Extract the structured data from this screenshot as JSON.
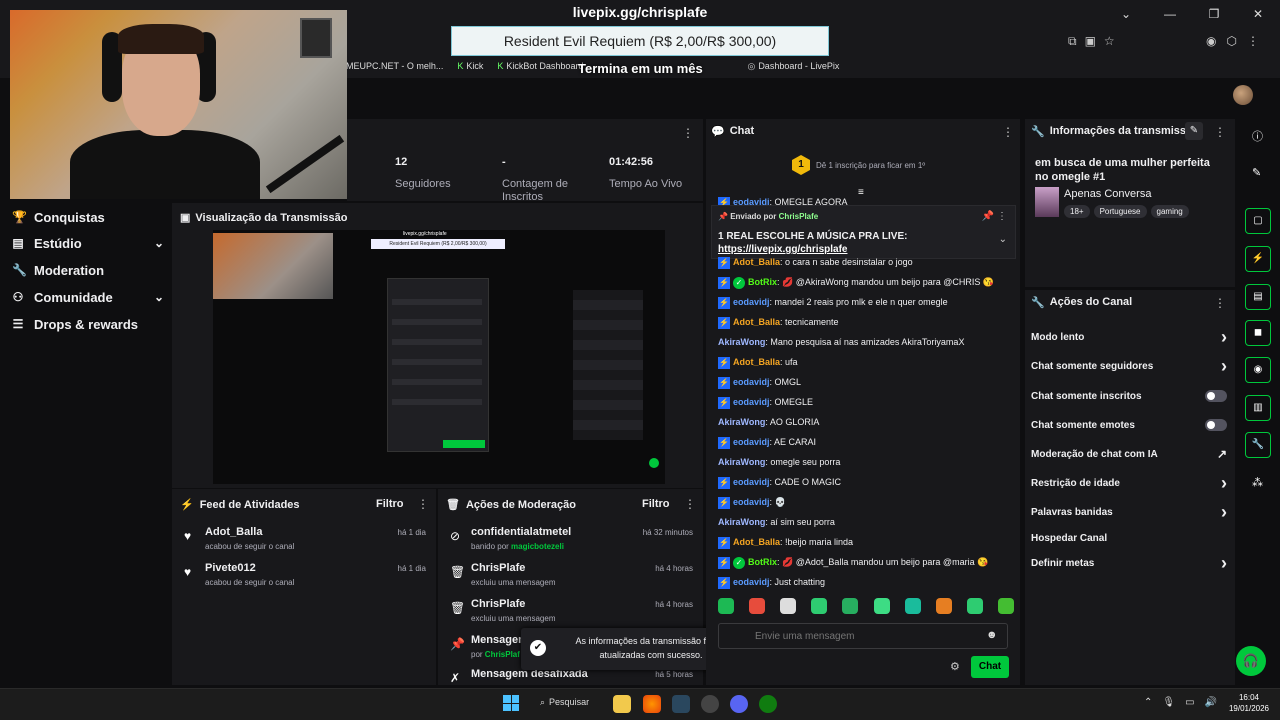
{
  "browser": {
    "url_title": "livepix.gg/chrisplafe",
    "window_controls": [
      "⌄",
      "—",
      "❐",
      "✕"
    ],
    "bookmarks": [
      {
        "label": "MEUPC.NET - O melh...",
        "icon": ""
      },
      {
        "label": "Kick",
        "icon": "K"
      },
      {
        "label": "KickBot Dashboard",
        "icon": "K"
      },
      {
        "label": "Dashboard - LivePix",
        "icon": "◎"
      }
    ]
  },
  "overlay": {
    "goal_banner": "Resident Evil Requiem (R$ 2,00/R$ 300,00)",
    "goal_sub": "Termina em um mês"
  },
  "nav": {
    "items": [
      {
        "label": "Conquistas",
        "icon": "trophy-icon"
      },
      {
        "label": "Estúdio",
        "icon": "video-icon"
      },
      {
        "label": "Moderation",
        "icon": "wrench-icon"
      },
      {
        "label": "Comunidade",
        "icon": "community-icon"
      },
      {
        "label": "Drops & rewards",
        "icon": "gift-icon"
      }
    ]
  },
  "stats": {
    "followers_value": "12",
    "followers_label": "Seguidores",
    "subs_value": "-",
    "subs_label": "Contagem de Inscritos",
    "uptime_value": "01:42:56",
    "uptime_label": "Tempo Ao Vivo"
  },
  "preview": {
    "title": "Visualização da Transmissão",
    "mini_url": "livepix.gg/chrisplafe",
    "mini_banner": "Resident Evil Requiem (R$ 2,00/R$ 300,00)"
  },
  "feed": {
    "title": "Feed de Atividades",
    "filter": "Filtro",
    "items": [
      {
        "name": "Adot_Balla",
        "sub": "acabou de seguir o canal",
        "time": "há 1 dia"
      },
      {
        "name": "Pivete012",
        "sub": "acabou de seguir o canal",
        "time": "há 1 dia"
      }
    ]
  },
  "mod_actions": {
    "title": "Ações de Moderação",
    "filter": "Filtro",
    "items": [
      {
        "icon": "⊘",
        "name": "confidentialatmetel",
        "sub": "banido por",
        "actor": "magicbotezeli",
        "time": "há 32 minutos"
      },
      {
        "icon": "🗑",
        "name": "ChrisPlafe",
        "sub": "excluiu uma mensagem",
        "actor": "",
        "time": "há 4 horas"
      },
      {
        "icon": "🗑",
        "name": "ChrisPlafe",
        "sub": "excluiu uma mensagem",
        "actor": "",
        "time": "há 4 horas"
      },
      {
        "icon": "📌",
        "name": "Mensagem",
        "sub": "por",
        "actor": "ChrisPlaf",
        "time": ""
      },
      {
        "icon": "✗",
        "name": "Mensagem desafixada",
        "sub": "",
        "actor": "",
        "time": "há 5 horas"
      }
    ]
  },
  "toast": {
    "text": "As informações da transmissão foram atualizadas com sucesso."
  },
  "chat": {
    "title": "Chat",
    "sub_promo": "Dê 1 inscrição para ficar em 1º",
    "sub_badge": "1",
    "pinned_by_label": "Enviado por",
    "pinned_by_user": "ChrisPlafe",
    "pinned_message": "1 REAL ESCOLHE A MÚSICA PRA LIVE: ",
    "pinned_link": "https://livepix.gg/chrisplafe",
    "partial_top": "OMEGLE AGORA",
    "messages": [
      {
        "user": "Adot_Balla",
        "color": "#f5a623",
        "badge": "prime",
        "text": ": o cara n sabe desinstalar o jogo"
      },
      {
        "user": "BotRix",
        "color": "#53fc18",
        "badge": "bot",
        "text": ": 💋 @AkiraWong mandou um beijo para @CHRIS 😘"
      },
      {
        "user": "eodavidj",
        "color": "#5b9bff",
        "badge": "prime",
        "text": ": mandei 2 reais pro mlk e ele n quer omegle"
      },
      {
        "user": "Adot_Balla",
        "color": "#f5a623",
        "badge": "prime",
        "text": ": tecnicamente"
      },
      {
        "user": "AkiraWong",
        "color": "#9fb8ff",
        "badge": "",
        "text": ": Mano pesquisa aí nas amizades AkiraToriyamaX"
      },
      {
        "user": "Adot_Balla",
        "color": "#f5a623",
        "badge": "prime",
        "text": ": ufa"
      },
      {
        "user": "eodavidj",
        "color": "#5b9bff",
        "badge": "prime",
        "text": ": OMGL"
      },
      {
        "user": "eodavidj",
        "color": "#5b9bff",
        "badge": "prime",
        "text": ": OMEGLE"
      },
      {
        "user": "AkiraWong",
        "color": "#9fb8ff",
        "badge": "",
        "text": ": AO GLORIA"
      },
      {
        "user": "eodavidj",
        "color": "#5b9bff",
        "badge": "prime",
        "text": ": AE CARAI"
      },
      {
        "user": "AkiraWong",
        "color": "#9fb8ff",
        "badge": "",
        "text": ": omegle seu porra"
      },
      {
        "user": "eodavidj",
        "color": "#5b9bff",
        "badge": "prime",
        "text": ": CADE O MAGIC"
      },
      {
        "user": "eodavidj",
        "color": "#5b9bff",
        "badge": "prime",
        "text": ": 💀"
      },
      {
        "user": "AkiraWong",
        "color": "#9fb8ff",
        "badge": "",
        "text": ": aí sim seu porra"
      },
      {
        "user": "Adot_Balla",
        "color": "#f5a623",
        "badge": "prime",
        "text": ": !beijo maria linda"
      },
      {
        "user": "BotRix",
        "color": "#53fc18",
        "badge": "bot",
        "text": ": 💋 @Adot_Balla mandou um beijo para @maria 😘"
      },
      {
        "user": "eodavidj",
        "color": "#5b9bff",
        "badge": "prime",
        "text": ": Just chatting"
      }
    ],
    "emote_colors": [
      "#1db954",
      "#e74c3c",
      "#dddddd",
      "#2ecc71",
      "#27ae60",
      "#3ddc84",
      "#1abc9c",
      "#e67e22",
      "#2ecc71",
      "#44bd32"
    ],
    "input_placeholder": "Envie uma mensagem",
    "send_label": "Chat"
  },
  "info": {
    "title": "Informações da transmissão",
    "stream_title": "em busca de uma mulher perfeita no omegle #1",
    "category": "Apenas Conversa",
    "tags": [
      "18+",
      "Portuguese",
      "gaming"
    ]
  },
  "channel": {
    "title": "Ações do Canal",
    "items": [
      {
        "label": "Modo lento",
        "control": "chevron"
      },
      {
        "label": "Chat somente seguidores",
        "control": "chevron"
      },
      {
        "label": "Chat somente inscritos",
        "control": "toggle"
      },
      {
        "label": "Chat somente emotes",
        "control": "toggle"
      },
      {
        "label": "Moderação de chat com IA",
        "control": "external"
      },
      {
        "label": "Restrição de idade",
        "control": "chevron"
      },
      {
        "label": "Palavras banidas",
        "control": "chevron"
      },
      {
        "label": "Hospedar Canal",
        "control": "none"
      },
      {
        "label": "Definir metas",
        "control": "chevron"
      }
    ]
  },
  "taskbar": {
    "search_label": "Pesquisar",
    "time": "16:04",
    "date": "19/01/2026"
  }
}
